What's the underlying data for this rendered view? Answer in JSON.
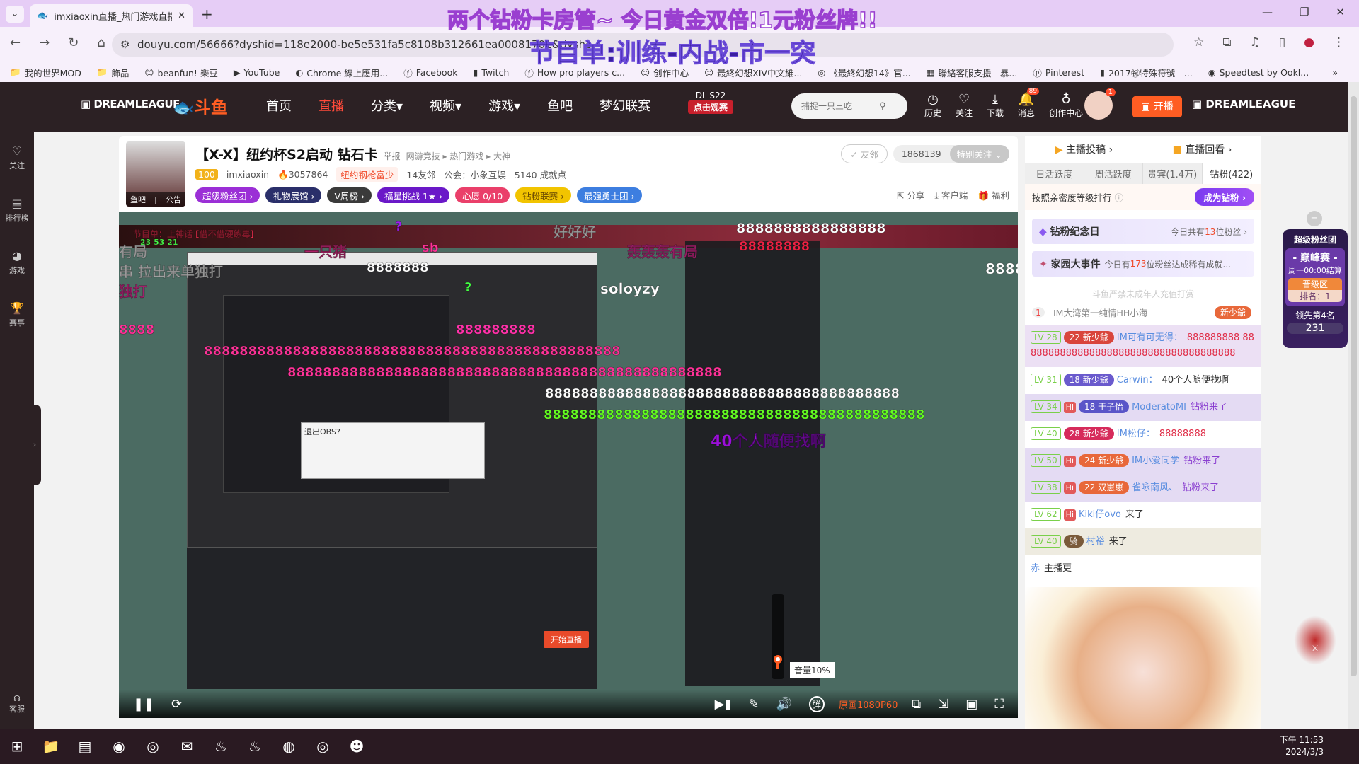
{
  "browser": {
    "tab_title": "imxiaoxin直播_热门游戏直播_",
    "url": "douyu.com/56666?dyshid=118e2000-be5e531fa5c8108b312661ea00081701&dyshc",
    "bookmarks": [
      "我的世界MOD",
      "飾品",
      "beanfun! 樂豆",
      "YouTube",
      "Chrome 線上應用...",
      "Facebook",
      "Twitch",
      "How pro players c...",
      "创作中心",
      "最終幻想XIV中文維...",
      "《最終幻想14》官...",
      "聯絡客服支援 - 暴...",
      "Pinterest",
      "2017㊗特殊符號 - ...",
      "Speedtest by Ookl..."
    ]
  },
  "overlay": {
    "line1": "两个钻粉卡房管~ 今日黄金双倍!1元粉丝牌!!",
    "line2": "节目单:训练-内战-市一突"
  },
  "header": {
    "nav": [
      "首页",
      "直播",
      "分类▾",
      "视频▾",
      "游戏▾",
      "鱼吧",
      "梦幻联赛"
    ],
    "active_nav": "直播",
    "event_title": "DL S22",
    "event_button": "点击观赛",
    "search_placeholder": "捕捉一只三吃",
    "icons": [
      {
        "label": "历史",
        "icon": "clock-icon"
      },
      {
        "label": "关注",
        "icon": "heart-icon"
      },
      {
        "label": "下载",
        "icon": "download-icon"
      },
      {
        "label": "消息",
        "icon": "bell-icon",
        "badge": "89"
      },
      {
        "label": "创作中心",
        "icon": "bulb-icon"
      }
    ],
    "avatar_badge": "1",
    "live_button": "开播",
    "accent": "#ff5d23"
  },
  "sidebar": {
    "items": [
      "关注",
      "排行榜",
      "游戏",
      "赛事"
    ],
    "bottom": "客服"
  },
  "room": {
    "title": "【X-X】纽约杯S2启动 钻石卡",
    "report": "举报",
    "categories": [
      "网游竞技",
      "热门游戏",
      "大神"
    ],
    "level": "100",
    "name": "imxiaoxin",
    "heat": "3057864",
    "tag": "纽约钢枪富少",
    "neighbors": "14友邻",
    "guild": "公会：小象互娱",
    "achievements": "5140 成就点",
    "avatar_links": [
      "鱼吧",
      "公告"
    ],
    "pills": [
      {
        "label": "超级粉丝团 ›",
        "color": "#9b2fd6"
      },
      {
        "label": "礼物展馆 ›",
        "color": "#2a2f6a"
      },
      {
        "label": "V周榜 ›",
        "color": "#3a3a3a"
      },
      {
        "label": "福星挑战  1★ ›",
        "color": "#6a18c8"
      },
      {
        "label": "心愿  0/10",
        "color": "#ea3f6a"
      },
      {
        "label": "钻粉联赛 ›",
        "color": "#f2c400"
      },
      {
        "label": "最强勇士团 ›",
        "color": "#3d7ee0"
      }
    ],
    "friend_button": "✓ 友邻",
    "followers": "1868139",
    "follow_button": "特别关注",
    "actions": [
      "分享",
      "客户端",
      "福利"
    ]
  },
  "video": {
    "danmaku": [
      {
        "t": "节目单：上神话 [借不借硬练毒]",
        "c": "#ff3355"
      },
      {
        "t": "23 53 21",
        "c": "#4cff4c"
      },
      {
        "t": "好好好",
        "c": "#ffffff"
      },
      {
        "t": "?",
        "c": "#a020f0"
      },
      {
        "t": "8888888888888888",
        "c": "#ffffff"
      },
      {
        "t": "88888888",
        "c": "#ee2244"
      },
      {
        "t": "有局",
        "c": "#ffffff"
      },
      {
        "t": "一只猪",
        "c": "#ff3399"
      },
      {
        "t": "sb",
        "c": "#ff3399"
      },
      {
        "t": "轰轰轰有局",
        "c": "#ff33aa"
      },
      {
        "t": "串 拉出来单独打",
        "c": "#ffffff"
      },
      {
        "t": "8888888",
        "c": "#ffffff"
      },
      {
        "t": "8888",
        "c": "#ffffff"
      },
      {
        "t": "soloyzy",
        "c": "#ffffff"
      },
      {
        "t": "独打",
        "c": "#ff33aa"
      },
      {
        "t": "?",
        "c": "#44ff44"
      },
      {
        "t": "8888",
        "c": "#ff3399"
      },
      {
        "t": "888888888",
        "c": "#ff33aa"
      },
      {
        "t": "88888888888888888888888888888888888888888888888",
        "c": "#ff3399"
      },
      {
        "t": "8888888888888888888888888888888888888888888888888",
        "c": "#ff3399"
      },
      {
        "t": "8888888888888888888888888888888888888888",
        "c": "#ffffff"
      },
      {
        "t": "8888888888888888888888888888888888888888888",
        "c": "#66ff22"
      },
      {
        "t": "40个人随便找啊",
        "c": "#9a10d8"
      }
    ],
    "volume_tooltip": "音量10%",
    "volume": 10,
    "quality": "原画1080P60",
    "danmaku_toggle": "弹",
    "obs_dialog": "退出OBS?",
    "obs_start": "开始直播"
  },
  "right": {
    "links": [
      "主播投稿 ›",
      "直播回看 ›"
    ],
    "tabs": [
      "日活跃度",
      "周活跃度",
      "贵宾(1.4万)",
      "钻粉(422)"
    ],
    "active_tab": "钻粉(422)",
    "sort_label": "按照亲密度等级排行",
    "become_button": "成为钻粉 ›",
    "anniv": {
      "title": "钻粉纪念日",
      "pre": "今日共有",
      "num": "13",
      "post": "位粉丝"
    },
    "events": {
      "title": "家园大事件",
      "pre": "今日有",
      "num": "173",
      "post": "位粉丝达成稀有成就..."
    },
    "notice": "斗鱼严禁未成年人充值打赏",
    "top_rank": {
      "rank": "1",
      "name": "IM大湾第一纯情HH小海",
      "badge": "新少爺"
    },
    "chat": [
      {
        "lv": "LV 28",
        "hi": false,
        "badge": "22 新少爺",
        "bc": "#d9453c",
        "user": "IM可有可无得：",
        "text": "888888888 8888888888888888888888888888888888888",
        "tc": "#e0304a",
        "bg": "#ece0f4"
      },
      {
        "lv": "LV 31",
        "hi": false,
        "badge": "18 新少爺",
        "bc": "#6a5acd",
        "user": "Carwin：",
        "text": "40个人随便找啊",
        "tc": "#333",
        "bg": "#fff"
      },
      {
        "lv": "LV 34",
        "hi": true,
        "badge": "18 于子怡",
        "bc": "#5a55c8",
        "user": "ModeratoMI",
        "text": "钻粉来了",
        "tc": "#8a3fd0",
        "bg": "#e4dbf3"
      },
      {
        "lv": "LV 40",
        "hi": false,
        "badge": "28 新少爺",
        "bc": "#d62b5b",
        "user": "IM松仔：",
        "text": "88888888",
        "tc": "#e0304a",
        "bg": "#fff"
      },
      {
        "lv": "LV 50",
        "hi": true,
        "badge": "24 新少爺",
        "bc": "#e8683a",
        "user": "IM小爱同学",
        "text": "钻粉来了",
        "tc": "#8a3fd0",
        "bg": "#e4dbf3"
      },
      {
        "lv": "LV 38",
        "hi": true,
        "badge": "22 双崽崽",
        "bc": "#e8683a",
        "user": "雀咏南风、",
        "text": "钻粉来了",
        "tc": "#8a3fd0",
        "bg": "#e4dbf3"
      },
      {
        "lv": "LV 62",
        "hi": true,
        "badge": "",
        "bc": "",
        "user": "Kiki仔ovo",
        "text": "来了",
        "tc": "#333",
        "bg": "#fff"
      },
      {
        "lv": "LV 40",
        "hi": false,
        "badge": "骑",
        "bc": "#7a5a3a",
        "user": "村裕",
        "text": "来了",
        "tc": "#333",
        "bg": "#eeebe0"
      },
      {
        "lv": "",
        "hi": false,
        "badge": "",
        "bc": "",
        "user": "赤",
        "text": "主播更",
        "tc": "#333",
        "bg": "#fff"
      }
    ]
  },
  "fan_badge": {
    "title": "超级粉丝团",
    "event": "- 巅峰赛 -",
    "deadline": "周一00:00结算",
    "zone": "晋级区",
    "rank": "排名：1",
    "lead": "领先第4名",
    "score": "231"
  },
  "taskbar": {
    "time": "下午 11:53",
    "date": "2024/3/3",
    "apps": [
      "file-explorer",
      "notepad",
      "chrome",
      "app-blue",
      "wechat",
      "steam",
      "steam-alt",
      "obs",
      "app-teal",
      "app-cat"
    ]
  }
}
